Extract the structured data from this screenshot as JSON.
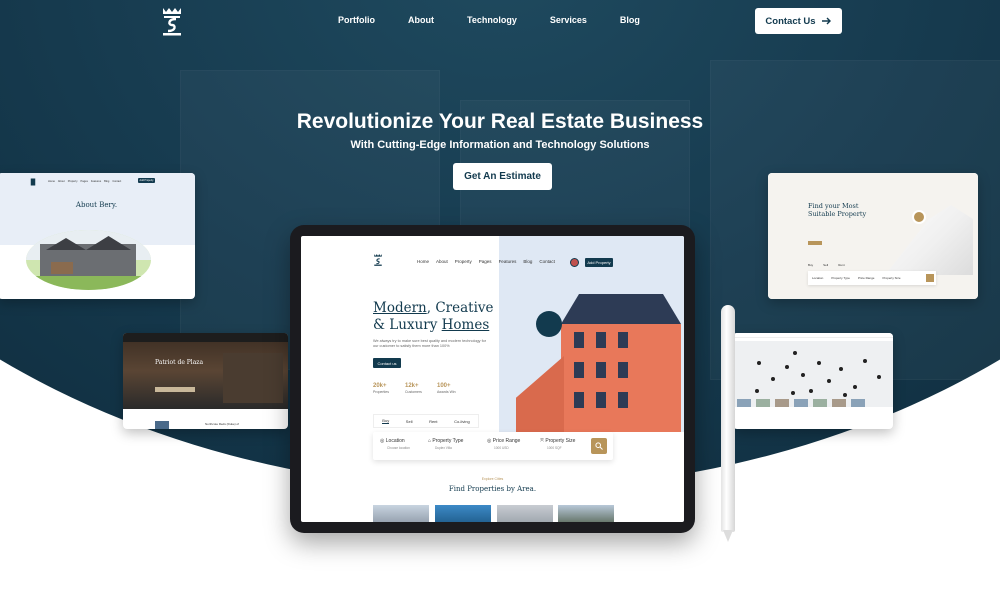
{
  "header": {
    "nav": [
      "Portfolio",
      "About",
      "Technology",
      "Services",
      "Blog"
    ],
    "contact_label": "Contact Us"
  },
  "hero": {
    "title": "Revolutionize Your Real Estate Business",
    "subtitle": "With Cutting-Edge Information and Technology Solutions",
    "cta_label": "Get An Estimate"
  },
  "about_card": {
    "nav": [
      "Home",
      "About",
      "Property",
      "Pages",
      "Features",
      "Blog",
      "Contact"
    ],
    "button": "Add Property",
    "title": "About Bery."
  },
  "plaza_card": {
    "title": "Patriot de Plaza",
    "caption": "Northcote Reds (Duke) of"
  },
  "suitable_card": {
    "title_line1": "Find your Most",
    "title_line2": "Suitable Property",
    "tabs": [
      "Buy",
      "Sell",
      "Rent"
    ],
    "fields": [
      "Location",
      "Property Type",
      "Price Range",
      "Property Size"
    ]
  },
  "tablet": {
    "nav": [
      "Home",
      "About",
      "Property",
      "Pages",
      "Features",
      "Blog",
      "Contact"
    ],
    "add_button": "Add Property",
    "headline_w1": "Modern",
    "headline_w2": ", Creative",
    "headline_w3": "& Luxury ",
    "headline_w4": "Homes",
    "paragraph": "We always try to make sure best quality and modern technology for our customer to satisfy them more than 100%",
    "contact_btn": "Contact us",
    "stats": [
      {
        "value": "20k+",
        "label": "Properties"
      },
      {
        "value": "12k+",
        "label": "Customers"
      },
      {
        "value": "100+",
        "label": "Awards Win"
      }
    ],
    "tabs": [
      "Buy",
      "Sell",
      "Rent",
      "Co-living"
    ],
    "search_fields": [
      {
        "label": "Location",
        "hint": "Choose location"
      },
      {
        "label": "Property Type",
        "hint": "Duplex Villa"
      },
      {
        "label": "Price Range",
        "hint": "1000 USD"
      },
      {
        "label": "Property Size",
        "hint": "1000 SQF"
      }
    ],
    "section_sub": "Explore Cities",
    "section_title": "Find Properties by Area."
  },
  "colors": {
    "navy": "#123a4e",
    "gold": "#b8955a",
    "bg": "#0e2b3c"
  }
}
